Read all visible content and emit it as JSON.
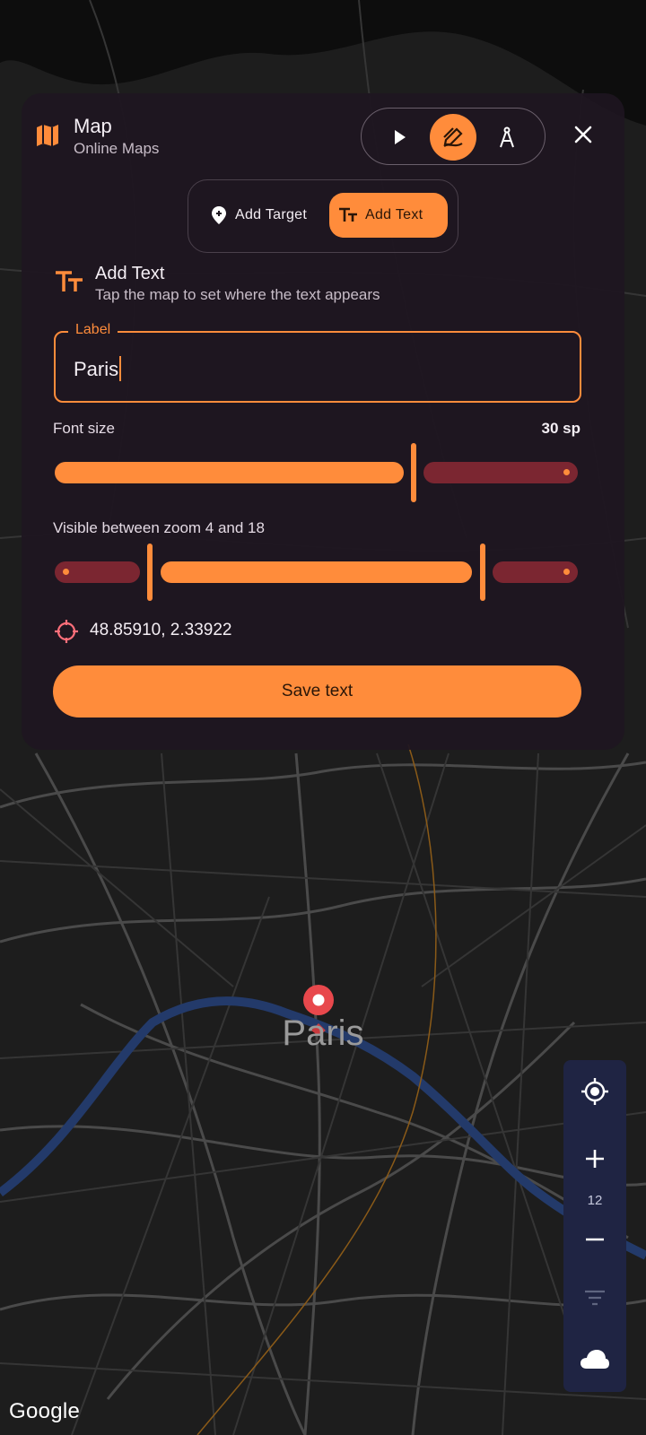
{
  "header": {
    "title": "Map",
    "subtitle": "Online Maps",
    "icons": {
      "app": "map-icon",
      "modes": [
        "play-icon",
        "draw-icon",
        "compass-icon"
      ],
      "close": "close-icon"
    },
    "active_mode": "draw"
  },
  "type_toggle": {
    "add_target_label": "Add Target",
    "add_text_label": "Add Text",
    "selected": "Add Text"
  },
  "section": {
    "title": "Add Text",
    "subtitle": "Tap the map to set where the text appears"
  },
  "label_field": {
    "legend": "Label",
    "value": "Paris"
  },
  "font_size": {
    "label": "Font size",
    "value_text": "30 sp",
    "fraction": 0.68
  },
  "zoom_range": {
    "label": "Visible between zoom 4 and 18",
    "min": 4,
    "max": 18
  },
  "coordinates": {
    "text": "48.85910, 2.33922"
  },
  "save_button": {
    "label": "Save text"
  },
  "map": {
    "label": "Paris",
    "attribution": "Google"
  },
  "map_controls": {
    "zoom_level": "12",
    "icons": [
      "my-location-icon",
      "zoom-in-icon",
      "zoom-out-icon",
      "filter-icon",
      "cloud-icon"
    ]
  },
  "colors": {
    "accent": "#ff8c3b",
    "inactive_track": "#7b2631",
    "panel": "#1e1620",
    "marker": "#e8484c",
    "controls_bg": "#1f2443"
  }
}
